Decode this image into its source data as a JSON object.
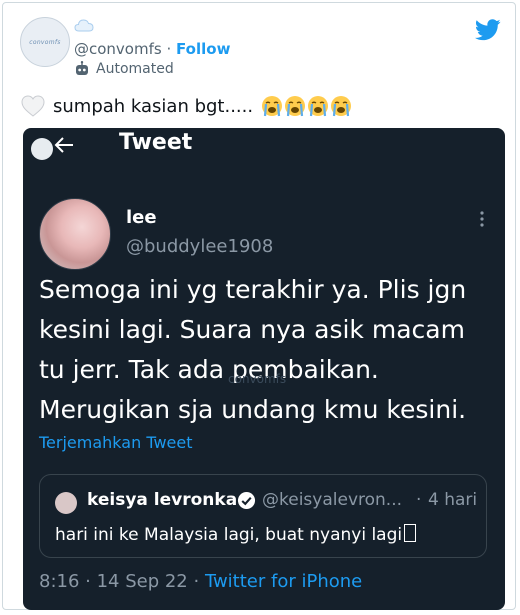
{
  "user": {
    "handle": "@convomfs",
    "follow_label": "Follow",
    "separator": "·",
    "automated_label": "Automated",
    "avatar_text": "convomfs"
  },
  "tweet": {
    "text": "sumpah kasian bgt.....",
    "emojis": [
      "loudly-crying-face",
      "loudly-crying-face",
      "loudly-crying-face",
      "loudly-crying-face"
    ]
  },
  "screenshot": {
    "header_title": "Tweet",
    "name": "lee",
    "handle": "@buddylee1908",
    "body": "Semoga ini yg terakhir ya. Plis jgn kesini lagi. Suara nya asik macam tu jerr. Tak ada pembaikan. Merugikan sja undang kmu kesini.",
    "watermark": "convomfs",
    "translate": "Terjemahkan Tweet",
    "quote": {
      "name": "keisya levronka",
      "handle": "@keisyalevron...",
      "dot": "·",
      "time": "4 hari",
      "text": "hari ini ke Malaysia lagi, buat nyanyi lagi"
    },
    "footer_time": "8:16 · 14 Sep 22 · ",
    "footer_source": "Twitter for iPhone"
  },
  "colors": {
    "twitter_blue": "#1d9bf0",
    "dark_bg": "#15202b"
  }
}
